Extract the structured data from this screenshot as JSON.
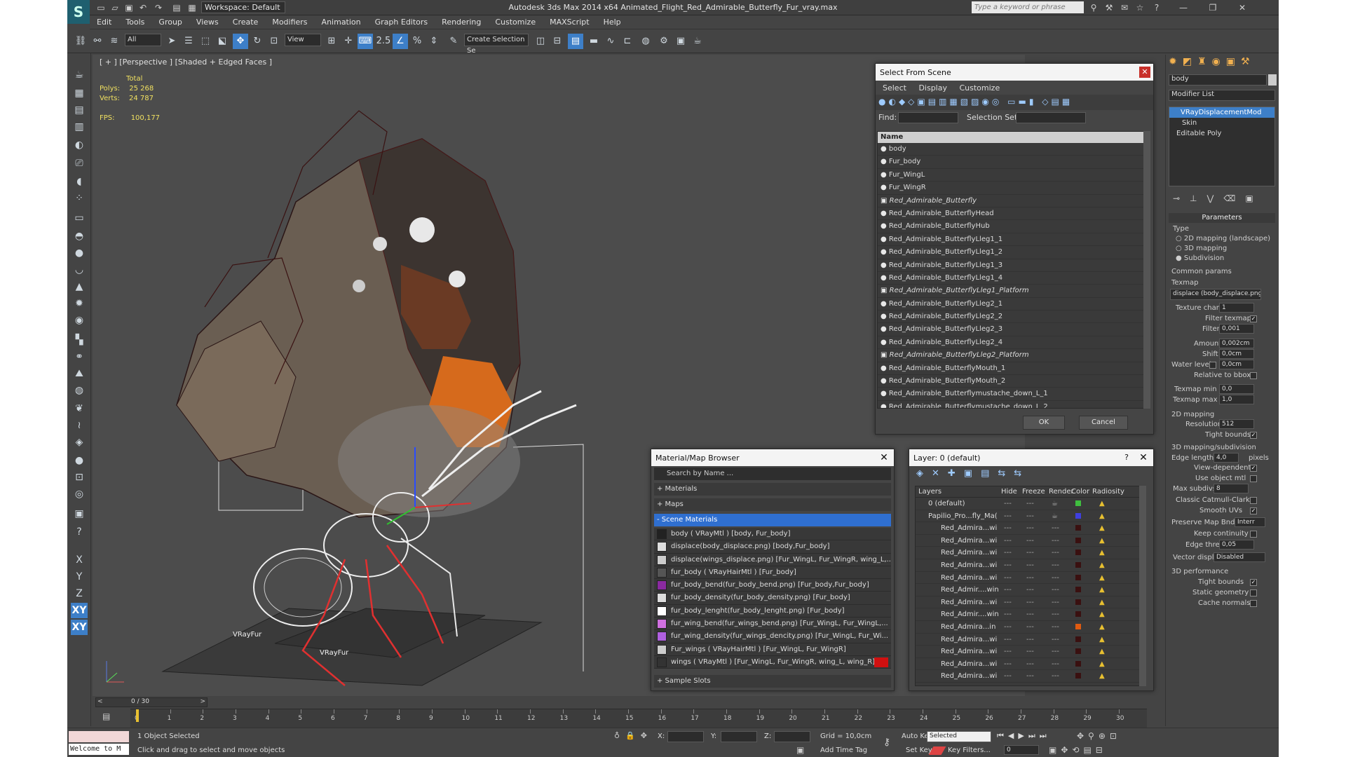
{
  "window": {
    "title": "Autodesk 3ds Max  2014 x64     Animated_Flight_Red_Admirable_Butterfly_Fur_vray.max",
    "workspace": "Workspace: Default",
    "search_placeholder": "Type a keyword or phrase"
  },
  "menu": [
    "Edit",
    "Tools",
    "Group",
    "Views",
    "Create",
    "Modifiers",
    "Animation",
    "Graph Editors",
    "Rendering",
    "Customize",
    "MAXScript",
    "Help"
  ],
  "toolbar": {
    "selection_filter": "All",
    "ref_coord": "View",
    "named_selection_placeholder": "Create Selection Se",
    "snap_label": "2.5"
  },
  "left_tools": {
    "x": "X",
    "y": "Y",
    "z": "Z",
    "xy": "XY",
    "xy2": "XY"
  },
  "viewport": {
    "label": "[ + ] [Perspective ] [Shaded + Edged Faces ]",
    "stats": {
      "total": "Total",
      "polys_label": "Polys:",
      "polys": "25 268",
      "verts_label": "Verts:",
      "verts": "24 787",
      "fps_label": "FPS:",
      "fps": "100,177"
    },
    "vrayfur_labels": [
      "VRayFur",
      "VRayFur"
    ]
  },
  "select_from_scene": {
    "title": "Select From Scene",
    "tabs": [
      "Select",
      "Display",
      "Customize"
    ],
    "find_label": "Find:",
    "selection_set_label": "Selection Set:",
    "column_name": "Name",
    "items": [
      {
        "name": "body",
        "italic": false
      },
      {
        "name": "Fur_body",
        "italic": false
      },
      {
        "name": "Fur_WingL",
        "italic": false
      },
      {
        "name": "Fur_WingR",
        "italic": false
      },
      {
        "name": "Red_Admirable_Butterfly",
        "italic": true
      },
      {
        "name": "Red_Admirable_ButterflyHead",
        "italic": false
      },
      {
        "name": "Red_Admirable_ButterflyHub",
        "italic": false
      },
      {
        "name": "Red_Admirable_ButterflyLleg1_1",
        "italic": false
      },
      {
        "name": "Red_Admirable_ButterflyLleg1_2",
        "italic": false
      },
      {
        "name": "Red_Admirable_ButterflyLleg1_3",
        "italic": false
      },
      {
        "name": "Red_Admirable_ButterflyLleg1_4",
        "italic": false
      },
      {
        "name": "Red_Admirable_ButterflyLleg1_Platform",
        "italic": true
      },
      {
        "name": "Red_Admirable_ButterflyLleg2_1",
        "italic": false
      },
      {
        "name": "Red_Admirable_ButterflyLleg2_2",
        "italic": false
      },
      {
        "name": "Red_Admirable_ButterflyLleg2_3",
        "italic": false
      },
      {
        "name": "Red_Admirable_ButterflyLleg2_4",
        "italic": false
      },
      {
        "name": "Red_Admirable_ButterflyLleg2_Platform",
        "italic": true
      },
      {
        "name": "Red_Admirable_ButterflyMouth_1",
        "italic": false
      },
      {
        "name": "Red_Admirable_ButterflyMouth_2",
        "italic": false
      },
      {
        "name": "Red_Admirable_Butterflymustache_down_L_1",
        "italic": false
      },
      {
        "name": "Red_Admirable_Butterflymustache_down_L_2",
        "italic": false
      }
    ],
    "ok": "OK",
    "cancel": "Cancel"
  },
  "material_browser": {
    "title": "Material/Map Browser",
    "search_placeholder": "Search by Name ...",
    "sections": {
      "materials": "+ Materials",
      "maps": "+ Maps",
      "scene": "- Scene Materials",
      "samples": "+ Sample Slots"
    },
    "items": [
      "body ( VRayMtl ) [body, Fur_body]",
      "displace(body_displace.png) [body,Fur_body]",
      "displace(wings_displace.png) [Fur_WingL, Fur_WingR, wing_L,...",
      "fur_body ( VRayHairMtl ) [Fur_body]",
      "fur_body_bend(fur_body_bend.png) [Fur_body,Fur_body]",
      "fur_body_density(fur_body_density.png) [Fur_body]",
      "fur_body_lenght(fur_body_lenght.png) [Fur_body]",
      "fur_wing_bend(fur_wings_bend.png) [Fur_WingL, Fur_WingL,...",
      "fur_wing_density(fur_wings_dencity.png) [Fur_WingL, Fur_Wi...",
      "Fur_wings ( VRayHairMtl ) [Fur_WingL, Fur_WingR]",
      "wings ( VRayMtl ) [Fur_WingL, Fur_WingR, wing_L, wing_R]"
    ]
  },
  "layer_dialog": {
    "title": "Layer: 0 (default)",
    "columns": [
      "Layers",
      "Hide",
      "Freeze",
      "Render",
      "Color",
      "Radiosity"
    ],
    "rows": [
      {
        "name": "0 (default)",
        "color": "#3fbf3f"
      },
      {
        "name": "Papilio_Pro...fly_Ma(",
        "color": "#3f3fdf"
      },
      {
        "name": "Red_Admira...wi",
        "color": "#3a1010"
      },
      {
        "name": "Red_Admira...wi",
        "color": "#3a1010"
      },
      {
        "name": "Red_Admira...wi",
        "color": "#3a1010"
      },
      {
        "name": "Red_Admira...wi",
        "color": "#3a1010"
      },
      {
        "name": "Red_Admira...wi",
        "color": "#3a1010"
      },
      {
        "name": "Red_Admir....win",
        "color": "#3a1010"
      },
      {
        "name": "Red_Admira...wi",
        "color": "#3a1010"
      },
      {
        "name": "Red_Admir....win",
        "color": "#3a1010"
      },
      {
        "name": "Red_Admira...in",
        "color": "#e05a10"
      },
      {
        "name": "Red_Admira...wi",
        "color": "#3a1010"
      },
      {
        "name": "Red_Admira...wi",
        "color": "#3a1010"
      },
      {
        "name": "Red_Admira...wi",
        "color": "#3a1010"
      },
      {
        "name": "Red_Admira...wi",
        "color": "#3a1010"
      }
    ]
  },
  "command_panel": {
    "object_name": "body",
    "modifier_list": "Modifier List",
    "stack": [
      "VRayDisplacementMod",
      "Skin",
      "Editable Poly"
    ],
    "parameters": "Parameters",
    "type_label": "Type",
    "type_options": [
      "2D mapping (landscape)",
      "3D mapping",
      "Subdivision"
    ],
    "common_params": "Common params",
    "texmap_label": "Texmap",
    "texmap_value": "displace (body_displace.png)",
    "texture_chan_label": "Texture chan",
    "texture_chan": "1",
    "filter_texmap": "Filter texmap",
    "filter_blur_label": "Filter blur",
    "filter_blur": "0,001",
    "amount_label": "Amount",
    "amount": "0,002cm",
    "shift_label": "Shift",
    "shift": "0,0cm",
    "water_level_label": "Water level",
    "water_level": "0,0cm",
    "relative_to_bbox": "Relative to bbox",
    "texmap_min_label": "Texmap min",
    "texmap_min": "0,0",
    "texmap_max_label": "Texmap max",
    "texmap_max": "1,0",
    "mapping2d": "2D mapping",
    "resolution_label": "Resolution",
    "resolution": "512",
    "tight_bounds": "Tight bounds",
    "mapping3d": "3D mapping/subdivision",
    "edge_length_label": "Edge length",
    "edge_length": "4,0",
    "pixels": "pixels",
    "view_dependent": "View-dependent",
    "use_object_mtl": "Use object mtl",
    "max_subdivs_label": "Max subdivs",
    "max_subdivs": "8",
    "classic_catmull": "Classic Catmull-Clark",
    "smooth_uvs": "Smooth UVs",
    "preserve_map_bnd_label": "Preserve Map Bnd",
    "preserve_map_bnd": "Interr",
    "keep_continuity": "Keep continuity",
    "edge_thresh_label": "Edge thresh",
    "edge_thresh": "0,05",
    "vector_displ_label": "Vector displ",
    "vector_displ": "Disabled",
    "perf": "3D performance",
    "perf_tight_bounds": "Tight bounds",
    "static_geometry": "Static geometry",
    "cache_normals": "Cache normals"
  },
  "timeline": {
    "frame_counter": "0 / 30",
    "ticks": [
      "0",
      "1",
      "2",
      "3",
      "4",
      "5",
      "6",
      "7",
      "8",
      "9",
      "10",
      "11",
      "12",
      "13",
      "14",
      "15",
      "16",
      "17",
      "18",
      "19",
      "20",
      "21",
      "22",
      "23",
      "24",
      "25",
      "26",
      "27",
      "28",
      "29",
      "30"
    ]
  },
  "status": {
    "listener": "Welcome to M",
    "selected": "1 Object Selected",
    "prompt": "Click and drag to select and move objects",
    "x_label": "X:",
    "y_label": "Y:",
    "z_label": "Z:",
    "grid": "Grid = 10,0cm",
    "add_time_tag": "Add Time Tag",
    "auto_key": "Auto Key",
    "set_key": "Set Key",
    "key_mode": "Selected",
    "key_filters": "Key Filters...",
    "frame": "0"
  }
}
